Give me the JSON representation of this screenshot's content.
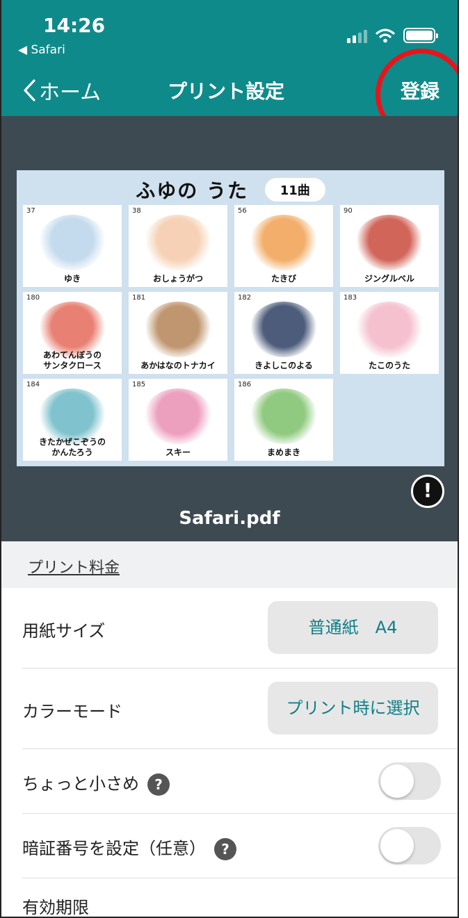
{
  "status": {
    "time": "14:26",
    "back_app": "◀ Safari"
  },
  "nav": {
    "back_label": "ホーム",
    "title": "プリント設定",
    "action_label": "登録"
  },
  "preview": {
    "page_title": "ふゆの うた",
    "song_count": "11曲",
    "cards": [
      {
        "num": "37",
        "label": "ゆき",
        "tint": "#b9d4ea"
      },
      {
        "num": "38",
        "label": "おしょうがつ",
        "tint": "#f4c9a8"
      },
      {
        "num": "56",
        "label": "たきび",
        "tint": "#f0a050"
      },
      {
        "num": "90",
        "label": "ジングルベル",
        "tint": "#c94a3c"
      },
      {
        "num": "180",
        "label": "あわてんぼうの\nサンタクロース",
        "tint": "#e46a5a"
      },
      {
        "num": "181",
        "label": "あかはなのトナカイ",
        "tint": "#b58457"
      },
      {
        "num": "182",
        "label": "きよしこのよる",
        "tint": "#2c3f63"
      },
      {
        "num": "183",
        "label": "たこのうた",
        "tint": "#f3b6c6"
      },
      {
        "num": "184",
        "label": "きたかぜこぞうの\nかんたろう",
        "tint": "#69b7c4"
      },
      {
        "num": "185",
        "label": "スキー",
        "tint": "#e98fb3"
      },
      {
        "num": "186",
        "label": "まめまき",
        "tint": "#7cc06a"
      }
    ],
    "file_name": "Safari.pdf"
  },
  "settings": {
    "fee_link": "プリント料金",
    "paper_size_label": "用紙サイズ",
    "paper_size_value": "普通紙　A4",
    "color_mode_label": "カラーモード",
    "color_mode_value": "プリント時に選択",
    "smaller_label": "ちょっと小さめ",
    "smaller_on": false,
    "pin_label": "暗証番号を設定（任意）",
    "pin_on": false,
    "expiry_label": "有効期限"
  },
  "colors": {
    "header": "#0f8a8a",
    "preview_bg": "#3e4a52",
    "accent_text": "#0f7f86",
    "annotation": "#e8141b"
  }
}
